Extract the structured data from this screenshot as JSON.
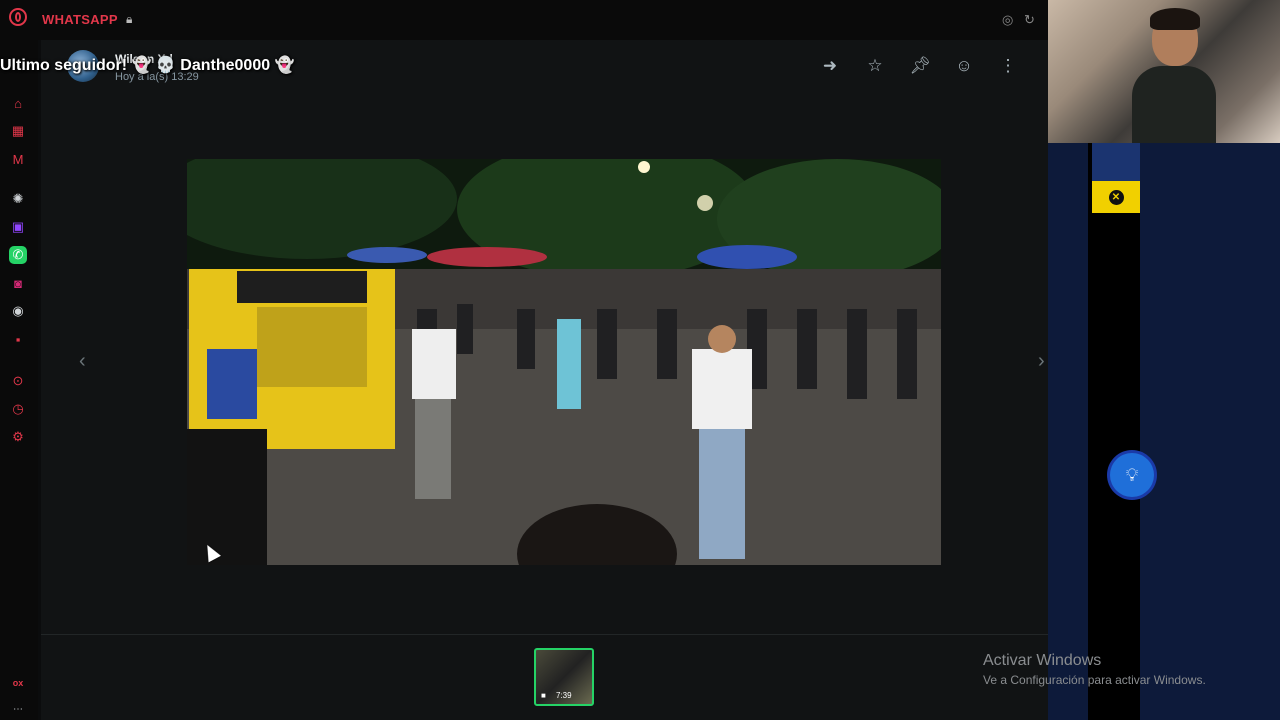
{
  "app": {
    "title": "WHATSAPP",
    "lock_icon": "lock-icon",
    "accent": "#e2374a"
  },
  "rail": {
    "icons": [
      "shop-icon",
      "ticket-icon",
      "mail-icon",
      "chatgpt-icon",
      "twitch-icon",
      "whatsapp-icon",
      "instagram-icon",
      "discord-icon",
      "game-icon",
      "circle-icon",
      "clock-icon",
      "settings-icon",
      "ox-icon",
      "more-icon"
    ],
    "bottom_label": "ox"
  },
  "viewer": {
    "sender": "Wilson Xd",
    "timestamp": "Hoy a la(s) 13:29",
    "header_actions": [
      "forward-icon",
      "star-icon",
      "pin-icon",
      "emoji-icon",
      "menu-icon"
    ],
    "thumbnail_duration": "7:39",
    "accent": "#25d366"
  },
  "stream_overlay": {
    "alert_text": "Ultimo seguidor! 👻 💀 Danthe0000 👻"
  },
  "windows_watermark": {
    "title": "Activar Windows",
    "subtitle": "Ve a Configuración para activar Windows."
  }
}
